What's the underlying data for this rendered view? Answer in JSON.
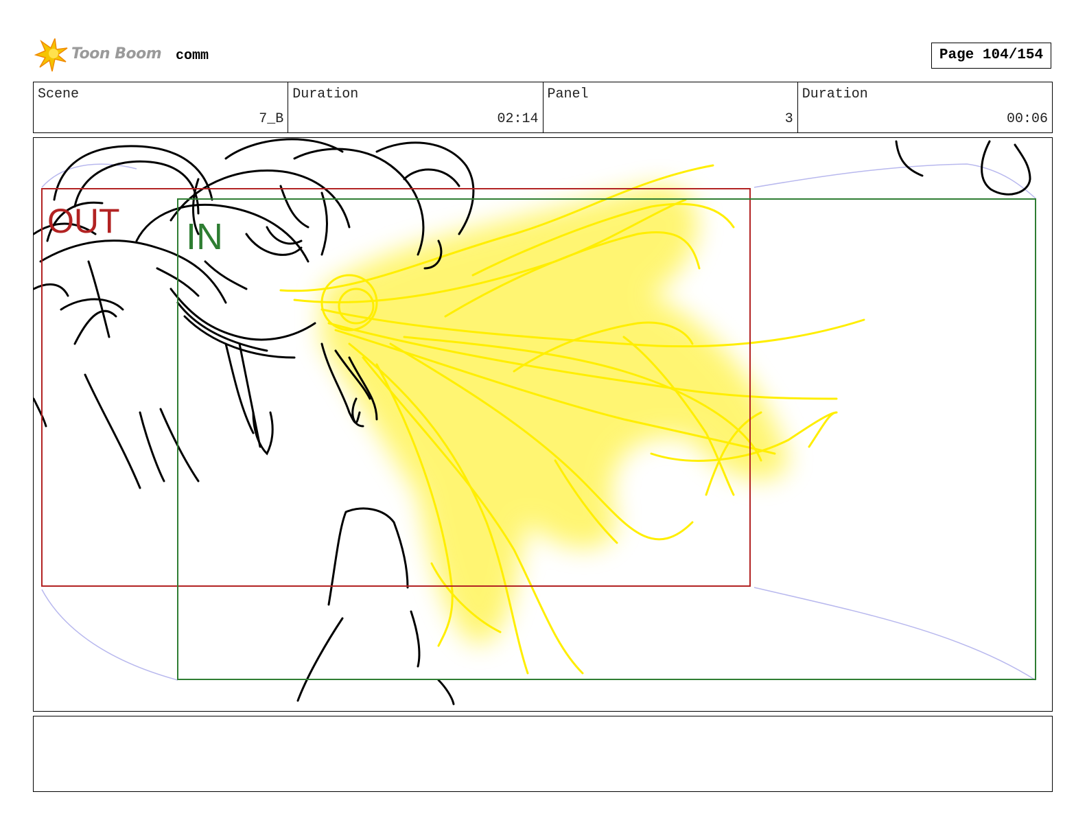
{
  "header": {
    "logo_text": "Toon Boom",
    "project_name": "comm",
    "page_label": "Page 104/154"
  },
  "info": {
    "scene_label": "Scene",
    "scene_value": "7_B",
    "scene_duration_label": "Duration",
    "scene_duration_value": "02:14",
    "panel_label": "Panel",
    "panel_value": "3",
    "panel_duration_label": "Duration",
    "panel_duration_value": "00:06"
  },
  "panel": {
    "out_label": "OUT",
    "in_label": "IN",
    "out_frame_color": "#b22222",
    "in_frame_color": "#2e7d32",
    "effect_color": "#ffee00",
    "motion_path_color": "#b8b8ee"
  },
  "notes": {
    "text": ""
  }
}
